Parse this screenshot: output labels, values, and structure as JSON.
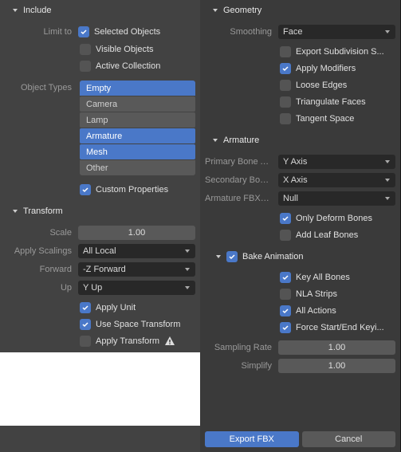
{
  "left": {
    "include": {
      "title": "Include",
      "limit_to_label": "Limit to",
      "selected_objects": "Selected Objects",
      "visible_objects": "Visible Objects",
      "active_collection": "Active Collection",
      "object_types_label": "Object Types",
      "types": {
        "empty": "Empty",
        "camera": "Camera",
        "lamp": "Lamp",
        "armature": "Armature",
        "mesh": "Mesh",
        "other": "Other"
      },
      "custom_props": "Custom Properties"
    },
    "transform": {
      "title": "Transform",
      "scale_label": "Scale",
      "scale_value": "1.00",
      "apply_scalings_label": "Apply Scalings",
      "apply_scalings_value": "All Local",
      "forward_label": "Forward",
      "forward_value": "-Z Forward",
      "up_label": "Up",
      "up_value": "Y Up",
      "apply_unit": "Apply Unit",
      "use_space_transform": "Use Space Transform",
      "apply_transform": "Apply Transform"
    }
  },
  "right": {
    "geometry": {
      "title": "Geometry",
      "smoothing_label": "Smoothing",
      "smoothing_value": "Face",
      "export_subdiv": "Export Subdivision S...",
      "apply_modifiers": "Apply Modifiers",
      "loose_edges": "Loose Edges",
      "triangulate": "Triangulate Faces",
      "tangent_space": "Tangent Space"
    },
    "armature": {
      "title": "Armature",
      "primary_label": "Primary Bone A...",
      "primary_value": "Y Axis",
      "secondary_label": "Secondary Bon...",
      "secondary_value": "X Axis",
      "fbxnode_label": "Armature FBXN...",
      "fbxnode_value": "Null",
      "only_deform": "Only Deform Bones",
      "add_leaf": "Add Leaf Bones"
    },
    "bake": {
      "title": "Bake Animation",
      "key_all": "Key All Bones",
      "nla": "NLA Strips",
      "all_actions": "All Actions",
      "force_start": "Force Start/End Keyi...",
      "sampling_label": "Sampling Rate",
      "sampling_value": "1.00",
      "simplify_label": "Simplify",
      "simplify_value": "1.00"
    },
    "footer": {
      "export": "Export FBX",
      "cancel": "Cancel"
    }
  }
}
